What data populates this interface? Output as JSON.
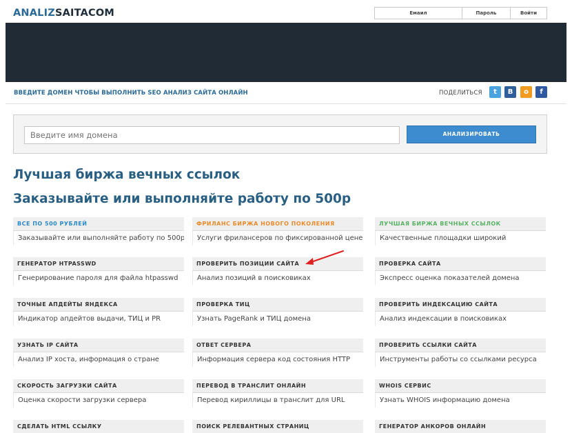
{
  "logo": {
    "part1": "ANALIZ",
    "part2": "SAITACOM"
  },
  "auth": {
    "email": "Емаил",
    "password": "Пароль",
    "login": "Войти"
  },
  "subbar": {
    "title": "ВВЕДИТЕ ДОМЕН ЧТОБЫ ВЫПОЛНИТЬ SEO АНАЛИЗ САЙТА ОНЛАЙН",
    "share_label": "ПОДЕЛИТЬСЯ",
    "share": [
      {
        "icon": "twitter-icon",
        "glyph": "t",
        "color": "#4aa3df"
      },
      {
        "icon": "vk-icon",
        "glyph": "B",
        "color": "#2f5f9a"
      },
      {
        "icon": "odnoklassniki-icon",
        "glyph": "о",
        "color": "#f29c1f"
      },
      {
        "icon": "facebook-icon",
        "glyph": "f",
        "color": "#2f5aa0"
      }
    ]
  },
  "search": {
    "placeholder": "Введите имя домена",
    "button": "АНАЛИЗИРОВАТЬ"
  },
  "headings": {
    "line1": "Лучшая биржа вечных ссылок",
    "line2": "Заказывайте или выполняйте работу по 500р"
  },
  "cards": [
    {
      "title": "ВСЕ ПО 500 РУБЛЕЙ",
      "desc": "Заказывайте или выполняйте работу по 500р",
      "accent": "#2a8ac4"
    },
    {
      "title": "ФРИЛАНС БИРЖА НОВОГО ПОКОЛЕНИЯ",
      "desc": "Услуги фрилансеров по фиксированной цене",
      "accent": "#e98a2a"
    },
    {
      "title": "ЛУЧШАЯ БИРЖА ВЕЧНЫХ ССЫЛОК",
      "desc": "Качественные площадки широкий",
      "accent": "#57b264"
    },
    {
      "title": "ГЕНЕРАТОР HTPASSWD",
      "desc": "Генерирование пароля для файла htpasswd"
    },
    {
      "title": "ПРОВЕРИТЬ ПОЗИЦИИ САЙТА",
      "desc": "Анализ позиций в поисковиках"
    },
    {
      "title": "ПРОВЕРКА САЙТА",
      "desc": "Экспресс оценка показателей домена"
    },
    {
      "title": "ТОЧНЫЕ АПДЕЙТЫ ЯНДЕКСА",
      "desc": "Индикатор апдейтов выдачи, ТИЦ и PR"
    },
    {
      "title": "ПРОВЕРКА ТИЦ",
      "desc": "Узнать PageRank и ТИЦ домена"
    },
    {
      "title": "ПРОВЕРИТЬ ИНДЕКСАЦИЮ САЙТА",
      "desc": "Анализ индексации в поисковиках"
    },
    {
      "title": "УЗНАТЬ IP САЙТА",
      "desc": "Анализ IP хоста, информация о стране"
    },
    {
      "title": "ОТВЕТ СЕРВЕРА",
      "desc": "Информация сервера код состояния HTTP"
    },
    {
      "title": "ПРОВЕРИТЬ ССЫЛКИ САЙТА",
      "desc": "Инструменты работы со ссылками ресурса"
    },
    {
      "title": "СКОРОСТЬ ЗАГРУЗКИ САЙТА",
      "desc": "Оценка скорости загрузки сервера"
    },
    {
      "title": "ПЕРЕВОД В ТРАНСЛИТ ОНЛАЙН",
      "desc": "Перевод кириллицы в транслит для URL"
    },
    {
      "title": "WHOIS СЕРВИС",
      "desc": "Узнать WHOIS информацию домена"
    },
    {
      "title": "СДЕЛАТЬ HTML ССЫЛКУ",
      "desc": ""
    },
    {
      "title": "ПОИСК РЕЛЕВАНТНЫХ СТРАНИЦ",
      "desc": ""
    },
    {
      "title": "ГЕНЕРАТОР АНКОРОВ ОНЛАЙН",
      "desc": ""
    }
  ],
  "annotation": {
    "arrow_color": "#e02020"
  }
}
